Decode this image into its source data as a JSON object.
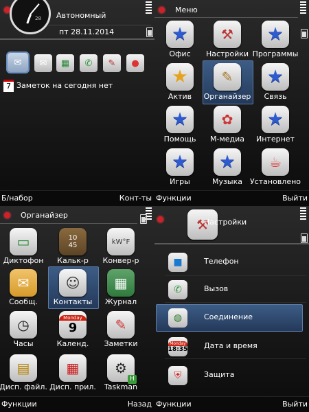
{
  "q1": {
    "profile": "Автономный",
    "date": "пт 28.11.2014",
    "clock_day": "28",
    "shortcuts": [
      "contacts-icon",
      "message-icon",
      "log-icon",
      "call-icon",
      "apps-icon",
      "browser-icon"
    ],
    "notes": "Заметок на сегодня нет",
    "cal_day": "7",
    "soft": {
      "left": "Б/набор",
      "right": "Конт-ты"
    }
  },
  "q2": {
    "title": "Меню",
    "items": [
      {
        "label": "Офис",
        "icon": "star-folder-icon"
      },
      {
        "label": "Настройки",
        "icon": "settings-tools-icon"
      },
      {
        "label": "Программы",
        "icon": "star-folder-icon"
      },
      {
        "label": "Актив",
        "icon": "star-folder-icon"
      },
      {
        "label": "Органайзер",
        "icon": "organizer-icon"
      },
      {
        "label": "Связь",
        "icon": "star-folder-icon"
      },
      {
        "label": "Помощь",
        "icon": "star-folder-icon"
      },
      {
        "label": "М-медиа",
        "icon": "media-icon"
      },
      {
        "label": "Интернет",
        "icon": "star-folder-icon"
      },
      {
        "label": "Игры",
        "icon": "star-folder-icon"
      },
      {
        "label": "Музыка",
        "icon": "star-folder-icon"
      },
      {
        "label": "Установлено",
        "icon": "java-icon"
      }
    ],
    "soft": {
      "left": "Функции",
      "right": "Выйти"
    }
  },
  "q3": {
    "title": "Органайзер",
    "items": [
      {
        "label": "Диктофон",
        "icon": "recorder-icon"
      },
      {
        "label": "Кальк-р",
        "icon": "calculator-icon"
      },
      {
        "label": "Конвер-р",
        "icon": "converter-icon"
      },
      {
        "label": "Сообщ.",
        "icon": "message-icon"
      },
      {
        "label": "Контакты",
        "icon": "contacts-icon"
      },
      {
        "label": "Журнал",
        "icon": "log-icon"
      },
      {
        "label": "Часы",
        "icon": "clock-icon"
      },
      {
        "label": "Календ.",
        "icon": "calendar-icon"
      },
      {
        "label": "Заметки",
        "icon": "notes-icon"
      },
      {
        "label": "Дисп. файл.",
        "icon": "file-manager-icon"
      },
      {
        "label": "Дисп. прил.",
        "icon": "app-manager-icon"
      },
      {
        "label": "Taskman",
        "icon": "taskman-icon"
      }
    ],
    "cal_month": "Monday",
    "cal_day": "9",
    "taskman_badge": "H",
    "soft": {
      "left": "Функции",
      "right": "Назад"
    }
  },
  "q4": {
    "title": "Настройки",
    "items": [
      {
        "label": "Телефон",
        "icon": "windows-phone-icon"
      },
      {
        "label": "Вызов",
        "icon": "call-icon"
      },
      {
        "label": "Соединение",
        "icon": "globe-icon"
      },
      {
        "label": "Дата и время",
        "icon": "datetime-icon"
      },
      {
        "label": "Защита",
        "icon": "shield-icon"
      }
    ],
    "dt_month": "Monday",
    "dt_time": "18:35",
    "soft": {
      "left": "Функции",
      "right": "Выйти"
    }
  }
}
